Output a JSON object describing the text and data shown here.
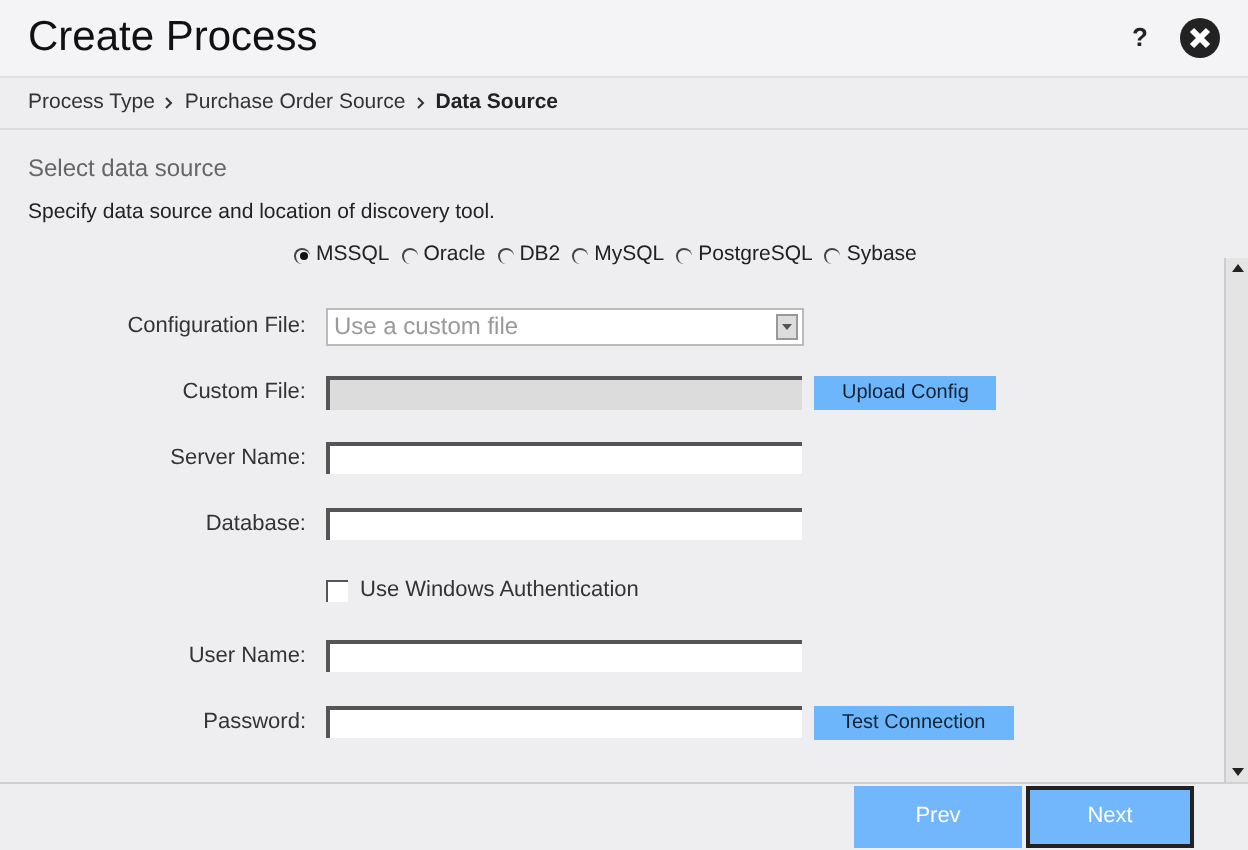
{
  "window": {
    "title": "Create Process",
    "help": "?"
  },
  "breadcrumb": [
    {
      "label": "Process Type",
      "selected": false
    },
    {
      "label": "Purchase Order Source",
      "selected": false
    },
    {
      "label": "Data Source",
      "selected": true
    }
  ],
  "section_title": "Select data source",
  "description": "Specify data source and location of discovery tool.",
  "sources": [
    {
      "label": "MSSQL",
      "selected": true
    },
    {
      "label": "Oracle",
      "selected": false
    },
    {
      "label": "DB2",
      "selected": false
    },
    {
      "label": "MySQL",
      "selected": false
    },
    {
      "label": "PostgreSQL",
      "selected": false
    },
    {
      "label": "Sybase",
      "selected": false
    }
  ],
  "fields": [
    {
      "kind": "select",
      "label": "Configuration File:",
      "placeholder": "Use a custom file"
    },
    {
      "kind": "readonly",
      "label": "Custom File:",
      "button": "Upload Config"
    },
    {
      "kind": "text",
      "label": "Server Name:"
    },
    {
      "kind": "text",
      "label": "Database:"
    },
    {
      "kind": "checkbox",
      "label": "Use Windows Authentication",
      "checked": false
    },
    {
      "kind": "text",
      "label": "User Name:"
    },
    {
      "kind": "password",
      "label": "Password:",
      "button": "Test Connection"
    }
  ],
  "buttons": [
    {
      "label": "Prev",
      "focused": false
    },
    {
      "label": "Next",
      "focused": true
    }
  ]
}
